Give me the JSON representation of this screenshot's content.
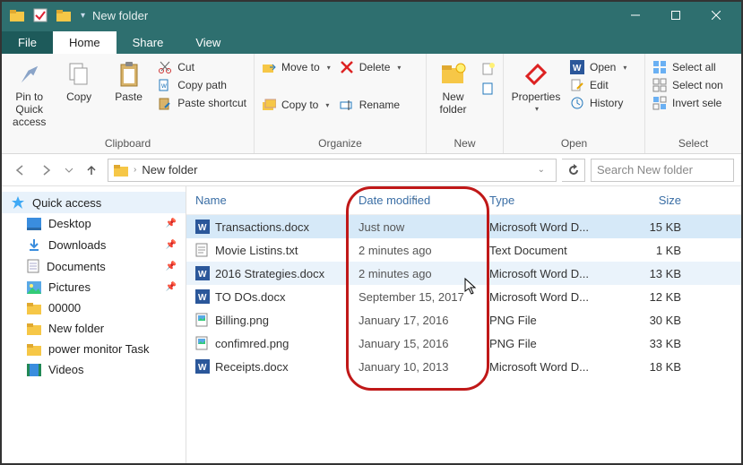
{
  "window": {
    "title": "New folder"
  },
  "tabs": {
    "file": "File",
    "home": "Home",
    "share": "Share",
    "view": "View"
  },
  "ribbon": {
    "clipboard": {
      "label": "Clipboard",
      "pin": "Pin to Quick access",
      "copy": "Copy",
      "paste": "Paste",
      "cut": "Cut",
      "copy_path": "Copy path",
      "paste_shortcut": "Paste shortcut"
    },
    "organize": {
      "label": "Organize",
      "move_to": "Move to",
      "copy_to": "Copy to",
      "delete": "Delete",
      "rename": "Rename"
    },
    "new": {
      "label": "New",
      "new_folder": "New folder"
    },
    "open": {
      "label": "Open",
      "properties": "Properties",
      "open": "Open",
      "edit": "Edit",
      "history": "History"
    },
    "select": {
      "label": "Select",
      "select_all": "Select all",
      "select_none": "Select non",
      "invert": "Invert sele"
    }
  },
  "address": {
    "folder": "New folder"
  },
  "search": {
    "placeholder": "Search New folder"
  },
  "sidebar": {
    "quick_access": "Quick access",
    "items": [
      {
        "label": "Desktop",
        "pinned": true
      },
      {
        "label": "Downloads",
        "pinned": true
      },
      {
        "label": "Documents",
        "pinned": true
      },
      {
        "label": "Pictures",
        "pinned": true
      },
      {
        "label": "00000",
        "pinned": false
      },
      {
        "label": "New folder",
        "pinned": false
      },
      {
        "label": "power monitor Task",
        "pinned": false
      },
      {
        "label": "Videos",
        "pinned": false
      }
    ]
  },
  "columns": {
    "name": "Name",
    "date": "Date modified",
    "type": "Type",
    "size": "Size"
  },
  "files": [
    {
      "name": "Transactions.docx",
      "date": "Just now",
      "type": "Microsoft Word D...",
      "size": "15 KB",
      "icon": "word",
      "sel": "sel"
    },
    {
      "name": "Movie Listins.txt",
      "date": "2 minutes ago",
      "type": "Text Document",
      "size": "1 KB",
      "icon": "txt",
      "sel": ""
    },
    {
      "name": "2016 Strategies.docx",
      "date": "2 minutes ago",
      "type": "Microsoft Word D...",
      "size": "13 KB",
      "icon": "word",
      "sel": "sel2"
    },
    {
      "name": "TO DOs.docx",
      "date": "September 15, 2017",
      "type": "Microsoft Word D...",
      "size": "12 KB",
      "icon": "word",
      "sel": ""
    },
    {
      "name": "Billing.png",
      "date": "January 17, 2016",
      "type": "PNG File",
      "size": "30 KB",
      "icon": "img",
      "sel": ""
    },
    {
      "name": "confimred.png",
      "date": "January 15, 2016",
      "type": "PNG File",
      "size": "33 KB",
      "icon": "img",
      "sel": ""
    },
    {
      "name": "Receipts.docx",
      "date": "January 10, 2013",
      "type": "Microsoft Word D...",
      "size": "18 KB",
      "icon": "word",
      "sel": ""
    }
  ]
}
